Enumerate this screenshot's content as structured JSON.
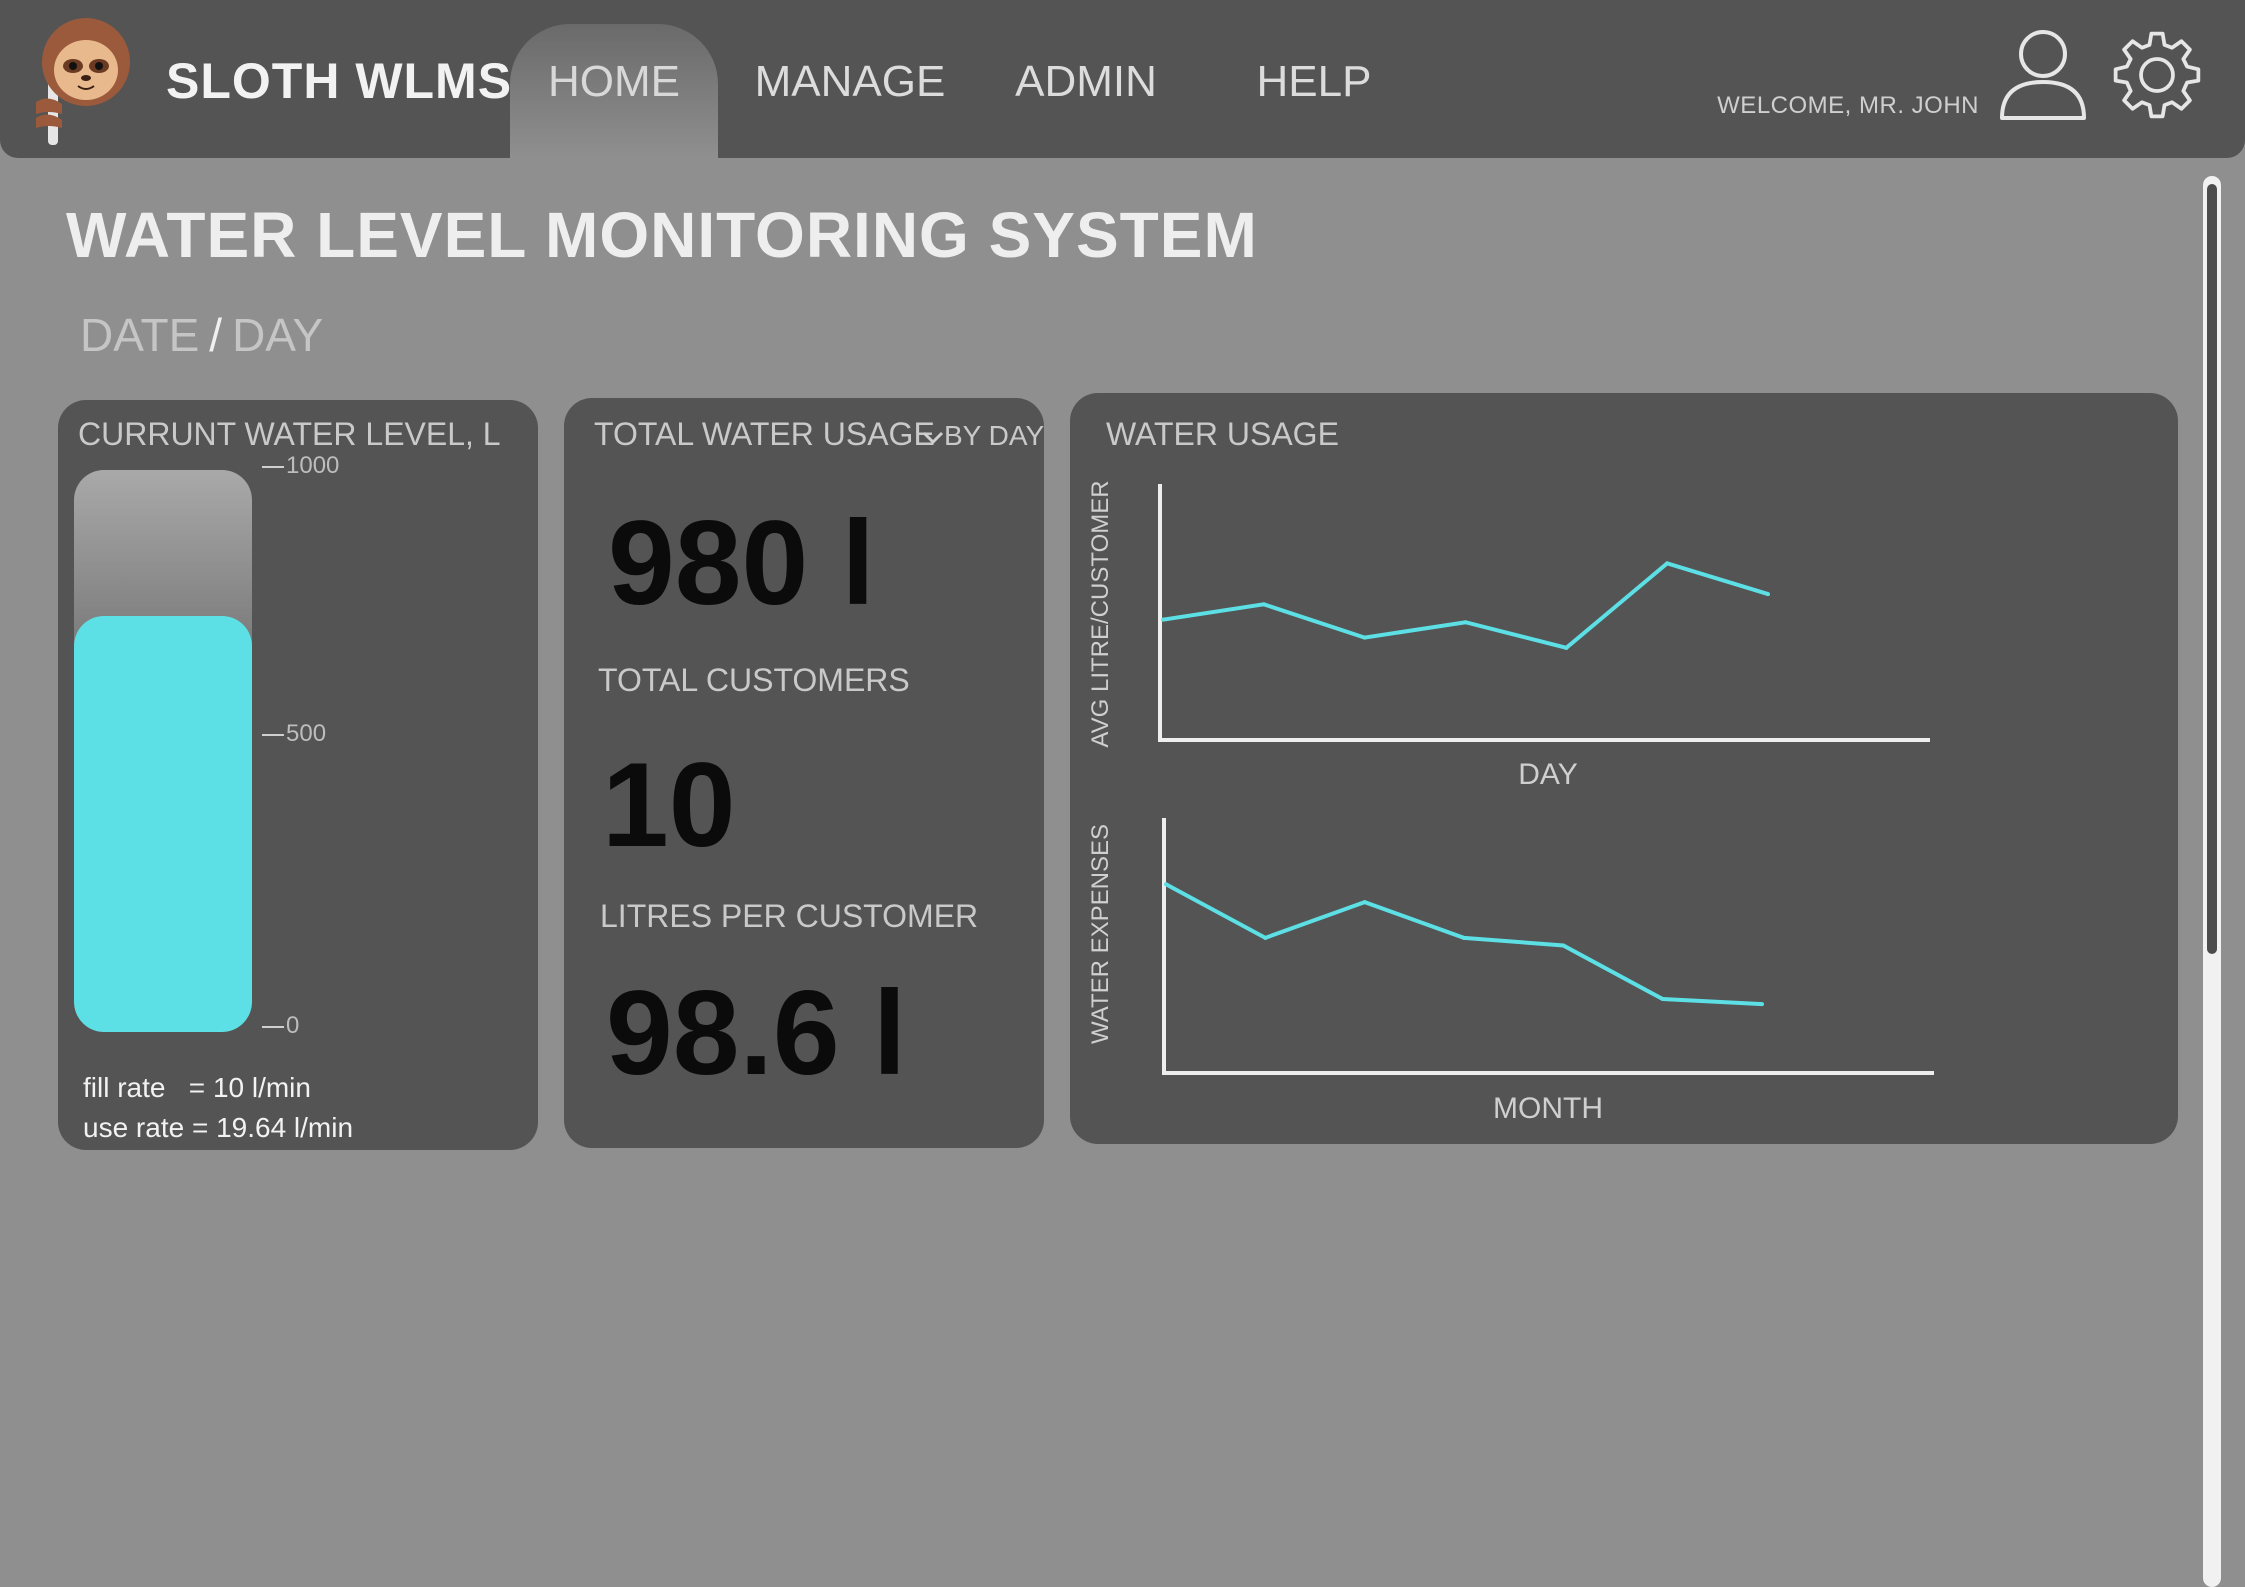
{
  "header": {
    "brand": "SLOTH WLMS",
    "nav": [
      {
        "label": "HOME",
        "active": true
      },
      {
        "label": "MANAGE",
        "active": false
      },
      {
        "label": "ADMIN",
        "active": false
      },
      {
        "label": "HELP",
        "active": false
      }
    ],
    "welcome": "WELCOME, MR. JOHN",
    "icons": [
      "sloth-logo-icon",
      "user-icon",
      "gear-icon"
    ]
  },
  "page": {
    "title": "WATER LEVEL MONITORING SYSTEM",
    "breadcrumb": {
      "first": "DATE",
      "separator": "/",
      "second": "DAY"
    }
  },
  "water_level": {
    "title": "CURRUNT WATER LEVEL, L",
    "ticks": [
      "1000",
      "500",
      "0"
    ],
    "max": 1000,
    "current_fraction": 0.74,
    "fill_rate": "fill rate   = 10 l/min",
    "use_rate": "use rate = 19.64 l/min"
  },
  "stats": {
    "title": "TOTAL WATER USAGE",
    "period": "BY DAY",
    "total_usage": "980 l",
    "customers_label": "TOTAL CUSTOMERS",
    "customers": "10",
    "per_customer_label": "LITRES PER CUSTOMER",
    "per_customer": "98.6 l"
  },
  "colors": {
    "accent": "#5ce0e5",
    "card": "#545454",
    "background": "#8f8f8f"
  },
  "chart_data": [
    {
      "type": "line",
      "title": "WATER USAGE",
      "xlabel": "DAY",
      "ylabel": "AVG LITRE/CUSTOMER",
      "x": [
        1,
        2,
        3,
        4,
        5,
        6,
        7,
        8
      ],
      "values": [
        47,
        53,
        40,
        46,
        36,
        69,
        57
      ],
      "ylim": [
        0,
        100
      ],
      "grid": false
    },
    {
      "type": "line",
      "xlabel": "MONTH",
      "ylabel": "WATER EXPENSES",
      "values": [
        74,
        53,
        67,
        53,
        50,
        29,
        27
      ],
      "ylim": [
        0,
        100
      ],
      "grid": false
    }
  ]
}
